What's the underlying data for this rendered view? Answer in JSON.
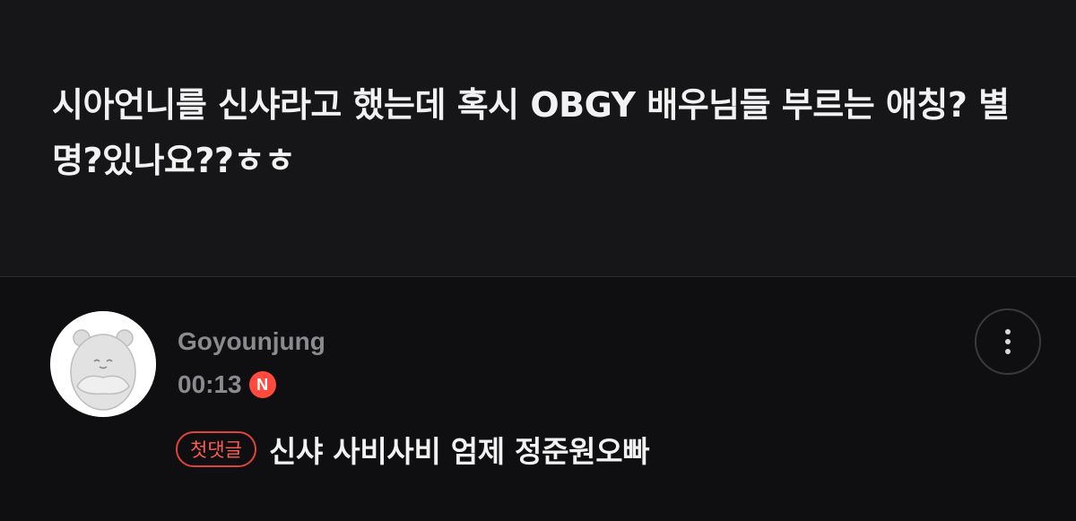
{
  "post": {
    "title": "시아언니를 신샤라고 했는데 혹시 OBGY 배우님들 부르는 애칭? 별명?있나요??ㅎㅎ"
  },
  "comment": {
    "username": "Goyounjung",
    "time": "00:13",
    "new_badge": "N",
    "first_comment_badge": "첫댓글",
    "text": "신샤 사비사비 엄제 정준원오빠",
    "more_icon": "more-vertical-icon",
    "avatar_icon": "character-avatar-icon"
  },
  "colors": {
    "background": "#161619",
    "comment_background": "#0f0f11",
    "badge_red": "#ff4a3d",
    "muted_text": "#8a8a8f"
  }
}
